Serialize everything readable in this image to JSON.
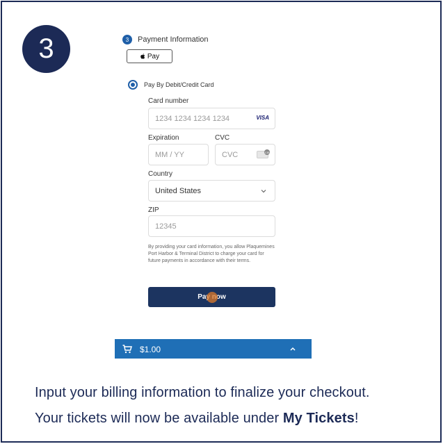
{
  "step": {
    "number": "3"
  },
  "section": {
    "number": "3",
    "title": "Payment Information"
  },
  "apple_pay": {
    "label": "Pay"
  },
  "payment_method": {
    "label": "Pay By Debit/Credit Card"
  },
  "card_number": {
    "label": "Card number",
    "placeholder": "1234 1234 1234 1234",
    "brand": "VISA"
  },
  "expiration": {
    "label": "Expiration",
    "placeholder": "MM / YY"
  },
  "cvc": {
    "label": "CVC",
    "placeholder": "CVC",
    "icon_text": "135"
  },
  "country": {
    "label": "Country",
    "value": "United States"
  },
  "zip": {
    "label": "ZIP",
    "placeholder": "12345"
  },
  "disclaimer": "By providing your card information, you allow Plaquemines Port Harbor & Terminal District to charge your card for future payments in accordance with their terms.",
  "pay_button": {
    "label": "Pay now"
  },
  "cart": {
    "total": "$1.00"
  },
  "caption": {
    "line1": "Input your billing information to finalize your checkout.",
    "line2_prefix": "Your tickets will now be available under ",
    "line2_bold": "My Tickets",
    "line2_suffix": "!"
  },
  "colors": {
    "navy": "#1c2a56",
    "accent_blue": "#1f5fa8",
    "cart_blue": "#1f6fb6",
    "button_navy": "#1c3460"
  },
  "icons": [
    "apple-icon",
    "visa-icon",
    "cvc-card-icon",
    "chevron-down-icon",
    "cart-icon",
    "chevron-up-icon"
  ]
}
